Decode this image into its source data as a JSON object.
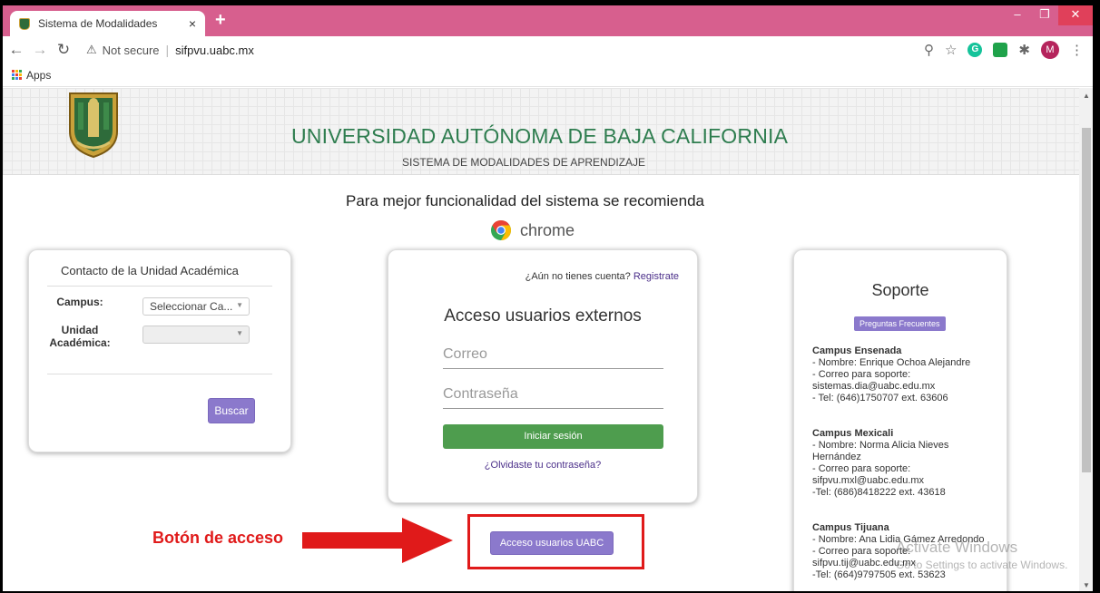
{
  "browser": {
    "tab_title": "Sistema de Modalidades",
    "tab_close": "×",
    "new_tab": "+",
    "security_label": "Not secure",
    "separator": "|",
    "url": "sifpvu.uabc.mx",
    "bookmark_apps": "Apps",
    "avatar_initial": "M",
    "ext_grammarly": "G",
    "colors": {
      "tab_strip": "#d75f8e",
      "close_button": "#e0405a"
    }
  },
  "header": {
    "title": "UNIVERSIDAD AUTÓNOMA DE BAJA CALIFORNIA",
    "subtitle": "SISTEMA DE MODALIDADES DE APRENDIZAJE"
  },
  "recommendation": {
    "text": "Para mejor funcionalidad del sistema se recomienda",
    "browser_name": "chrome"
  },
  "contact": {
    "title": "Contacto de la Unidad Académica",
    "campus_label": "Campus:",
    "campus_value": "Seleccionar Ca...",
    "unit_label_1": "Unidad",
    "unit_label_2": "Académica:",
    "unit_value": "",
    "search_button": "Buscar"
  },
  "login": {
    "no_account": "¿Aún no tienes cuenta?",
    "register": "Registrate",
    "title": "Acceso usuarios externos",
    "email_placeholder": "Correo",
    "password_placeholder": "Contraseña",
    "login_button": "Iniciar sesión",
    "forgot": "¿Olvidaste tu contraseña?",
    "button_color": "#4e9d4e"
  },
  "uabc_access": {
    "button": "Acceso usuarios UABC",
    "annotation": "Botón de acceso",
    "annotation_color": "#e01a1a"
  },
  "support": {
    "title": "Soporte",
    "faq_button": "Preguntas Frecuentes",
    "campuses": [
      {
        "name": "Campus Ensenada",
        "lines": [
          "- Nombre: Enrique Ochoa Alejandre",
          "- Correo para soporte:",
          "sistemas.dia@uabc.edu.mx",
          "- Tel: (646)1750707 ext. 63606"
        ]
      },
      {
        "name": "Campus Mexicali",
        "lines": [
          "- Nombre: Norma Alicia Nieves",
          "Hernández",
          "- Correo para soporte:",
          "sifpvu.mxl@uabc.edu.mx",
          "-Tel: (686)8418222 ext. 43618"
        ]
      },
      {
        "name": "Campus Tijuana",
        "lines": [
          "- Nombre: Ana Lidia Gámez Arredondo",
          "- Correo para soporte:",
          "sifpvu.tij@uabc.edu.mx",
          "-Tel: (664)9797505 ext. 53623"
        ]
      }
    ]
  },
  "watermark": {
    "line1": "Activate Windows",
    "line2": "Go to Settings to activate Windows."
  },
  "accent_color": "#8b79cc",
  "title_color": "#2e7d4f"
}
